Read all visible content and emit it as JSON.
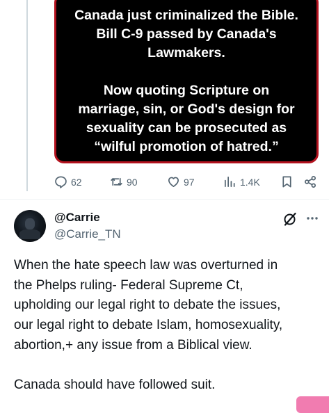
{
  "quoted_image": {
    "lines_1": [
      "Canada just criminalized the Bible.",
      "Bill C-9 passed by Canada's",
      "Lawmakers."
    ],
    "lines_2": [
      "Now quoting Scripture on",
      "marriage, sin, or God's design for",
      "sexuality can be prosecuted as",
      "“wilful promotion of hatred.”"
    ]
  },
  "actions": {
    "reply_count": "62",
    "repost_count": "90",
    "like_count": "97",
    "views_count": "1.4K"
  },
  "reply": {
    "display_name": "@Carrie",
    "handle": "@Carrie_TN",
    "text_lines": [
      "When the hate speech law was overturned in",
      "the Phelps ruling- Federal Supreme Ct,",
      "upholding our legal right to debate the issues,",
      "our legal right to debate Islam, homosexuality,",
      "abortion,+ any issue from a Biblical view."
    ],
    "text_line_last": "Canada should have followed suit."
  },
  "colors": {
    "text_primary": "#0f1419",
    "text_secondary": "#536471",
    "image_border": "#b3121e",
    "fab": "#f17cb0"
  },
  "icons": [
    "reply-icon",
    "repost-icon",
    "like-icon",
    "views-icon",
    "bookmark-icon",
    "share-icon",
    "grok-icon",
    "more-icon"
  ]
}
